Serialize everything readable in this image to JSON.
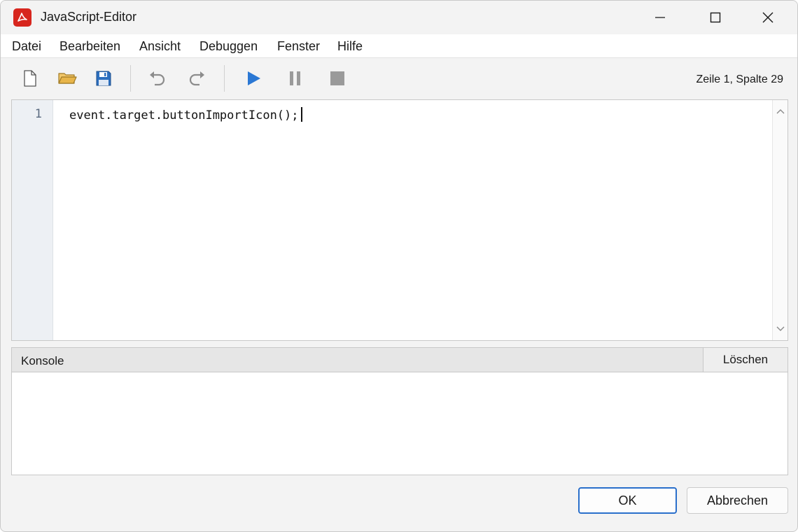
{
  "window": {
    "title": "JavaScript-Editor"
  },
  "menu": {
    "items": [
      "Datei",
      "Bearbeiten",
      "Ansicht",
      "Debuggen",
      "Fenster",
      "Hilfe"
    ]
  },
  "toolbar": {
    "buttons": [
      "new-file-icon",
      "open-folder-icon",
      "save-icon",
      "undo-icon",
      "redo-icon",
      "run-icon",
      "pause-icon",
      "stop-icon"
    ],
    "cursor_position": "Zeile 1, Spalte 29"
  },
  "editor": {
    "lines": [
      {
        "number": "1",
        "code": "event.target.buttonImportIcon();"
      }
    ]
  },
  "console": {
    "title": "Konsole",
    "clear_label": "Löschen",
    "output": ""
  },
  "dialog": {
    "ok_label": "OK",
    "cancel_label": "Abbrechen"
  },
  "colors": {
    "accent": "#2a6fcb",
    "run": "#2b78d4",
    "app_icon": "#d7261e",
    "folder": "#e8b54a",
    "save": "#2c6fbf"
  }
}
